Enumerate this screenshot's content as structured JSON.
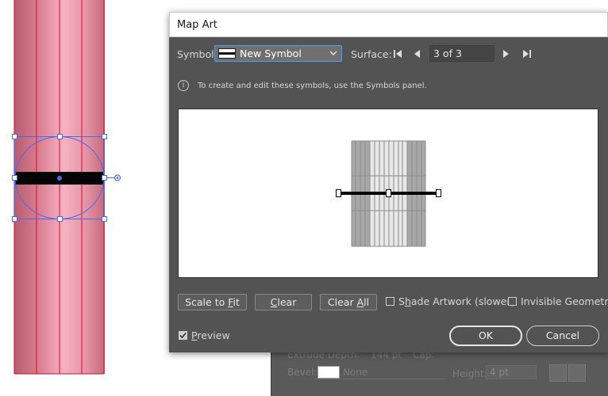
{
  "dialog": {
    "title": "Map Art",
    "symbol_label": "Symbol:",
    "symbol_value": "New Symbol",
    "surface_label": "Surface:",
    "surface_value": "3 of 3",
    "info_text": "To create and edit these symbols, use the Symbols panel.",
    "scale_to_fit_pre": "Scale to ",
    "scale_to_fit_key": "F",
    "scale_to_fit_post": "it",
    "clear_key": "C",
    "clear_post": "lear",
    "clear_all_pre": "Clear ",
    "clear_all_key": "A",
    "clear_all_post": "ll",
    "shade_pre": "S",
    "shade_key": "h",
    "shade_post": "ade Artwork (slower)",
    "invisible_geometry": "Invisible Geometry",
    "preview_key": "P",
    "preview_post": "review",
    "preview_checked": true,
    "ok": "OK",
    "cancel": "Cancel",
    "icons": [
      "chevron-down-icon",
      "first-surface-icon",
      "previous-surface-icon",
      "next-surface-icon",
      "last-surface-icon",
      "info-icon",
      "checkmark-icon"
    ]
  },
  "background_panel": {
    "extrude_depth_label": "Extrude Depth:",
    "extrude_depth_value": "144 pt",
    "cap_label": "Cap:",
    "bevel_label": "Bevel:",
    "bevel_value": "None",
    "height_label": "Height:",
    "height_value": "4 pt"
  },
  "colors": {
    "dialog_bg": "#535353",
    "accent_focus": "#4aa0ff",
    "selection_blue": "#4a6ae8",
    "cylinder_pink": "#e8889a"
  }
}
